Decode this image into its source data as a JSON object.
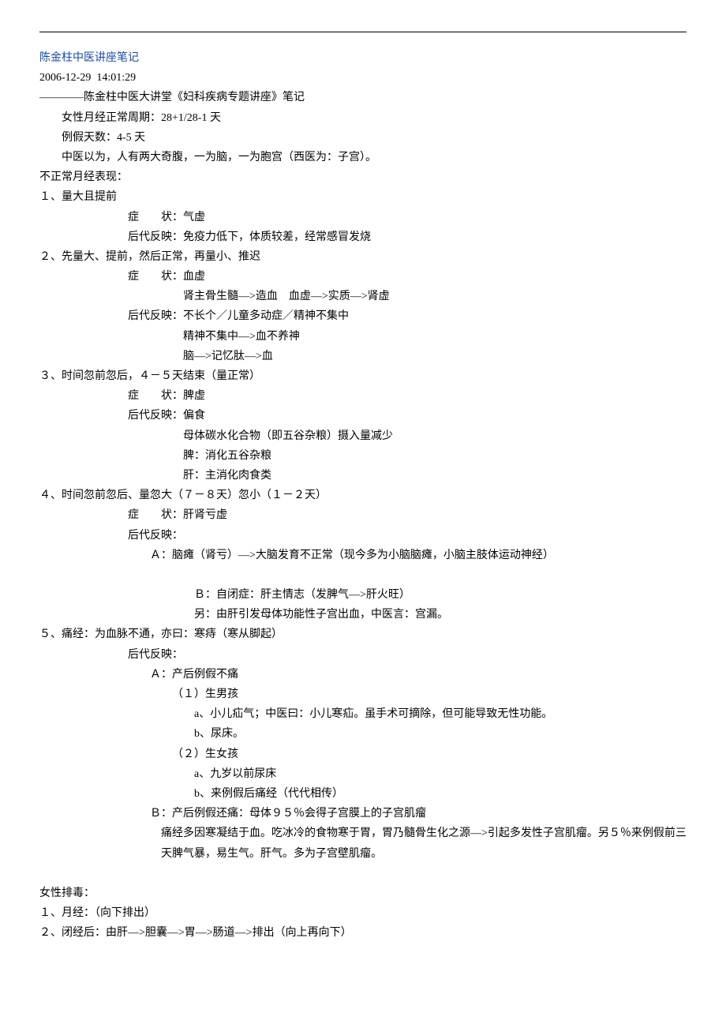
{
  "title": "陈金柱中医讲座笔记",
  "timestamp": "2006-12-29  14:01:29",
  "subtitle": "————陈金柱中医大讲堂《妇科疾病专题讲座》笔记",
  "intro": [
    "女性月经正常周期：28+1/28-1 天",
    "例假天数：4-5 天",
    "中医以为，人有两大奇腹，一为脑，一为胞宫（西医为：子宫）。"
  ],
  "abnormal_header": "不正常月经表现：",
  "sections": [
    {
      "num": "１、量大且提前",
      "symptom_label": "症　　状：",
      "symptom": "气虚",
      "refl_label": "后代反映：",
      "refl": [
        "免疫力低下，体质较差，经常感冒发烧"
      ]
    },
    {
      "num": "２、先量大、提前，然后正常，再量小、推迟",
      "symptom_label": "症　　状：",
      "symptom": "血虚",
      "symptom_sub": [
        "肾主骨生髓—>造血　血虚—>实质—>肾虚"
      ],
      "refl_label": "后代反映：",
      "refl": [
        "不长个／儿童多动症／精神不集中",
        "精神不集中—>血不养神",
        "脑—>记忆肽—>血"
      ]
    },
    {
      "num": "３、时间忽前忽后，４－５天结束（量正常）",
      "symptom_label": "症　　状：",
      "symptom": "脾虚",
      "refl_label": "后代反映：",
      "refl": [
        "偏食",
        "母体碳水化合物（即五谷杂粮）摄入量减少",
        "脾：消化五谷杂粮",
        "肝：主消化肉食类"
      ]
    },
    {
      "num": "４、时间忽前忽后、量忽大（７－８天）忽小（１－２天）",
      "symptom_label": "症　　状：",
      "symptom": "肝肾亏虚",
      "refl_label": "后代反映：",
      "refl_sub": [
        "Ａ：脑瘫（肾亏）—>大脑发育不正常（现今多为小脑脑瘫，小脑主肢体运动神经）",
        "",
        "Ｂ：自闭症：肝主情志（发脾气—>肝火旺）",
        "另：由肝引发母体功能性子宫出血，中医言：宫漏。"
      ]
    },
    {
      "num": "５、痛经：为血脉不通，亦曰：寒痔（寒从脚起）",
      "refl_label": "后代反映：",
      "dysmenorrhea": {
        "A": "Ａ：产后例假不痛",
        "boy_h": "（１）生男孩",
        "boy": [
          "a、小儿疝气；中医曰：小儿寒疝。虽手术可摘除，但可能导致无性功能。",
          "b、尿床。"
        ],
        "girl_h": "（２）生女孩",
        "girl": [
          "a、九岁以前尿床",
          "b、来例假后痛经（代代相传）"
        ],
        "B": "Ｂ：产后例假还痛：母体９５％会得子宫膜上的子宫肌瘤",
        "B_note": "痛经多因寒凝结于血。吃冰冷的食物寒于胃，胃乃髓骨生化之源—>引起多发性子宫肌瘤。另５％来例假前三天脾气暴，易生气。肝气。多为子宫壁肌瘤。"
      }
    }
  ],
  "detox": {
    "header": "女性排毒：",
    "items": [
      "１、月经：（向下排出）",
      "２、闭经后：由肝—>胆囊—>胃—>肠道—>排出（向上再向下）"
    ]
  }
}
